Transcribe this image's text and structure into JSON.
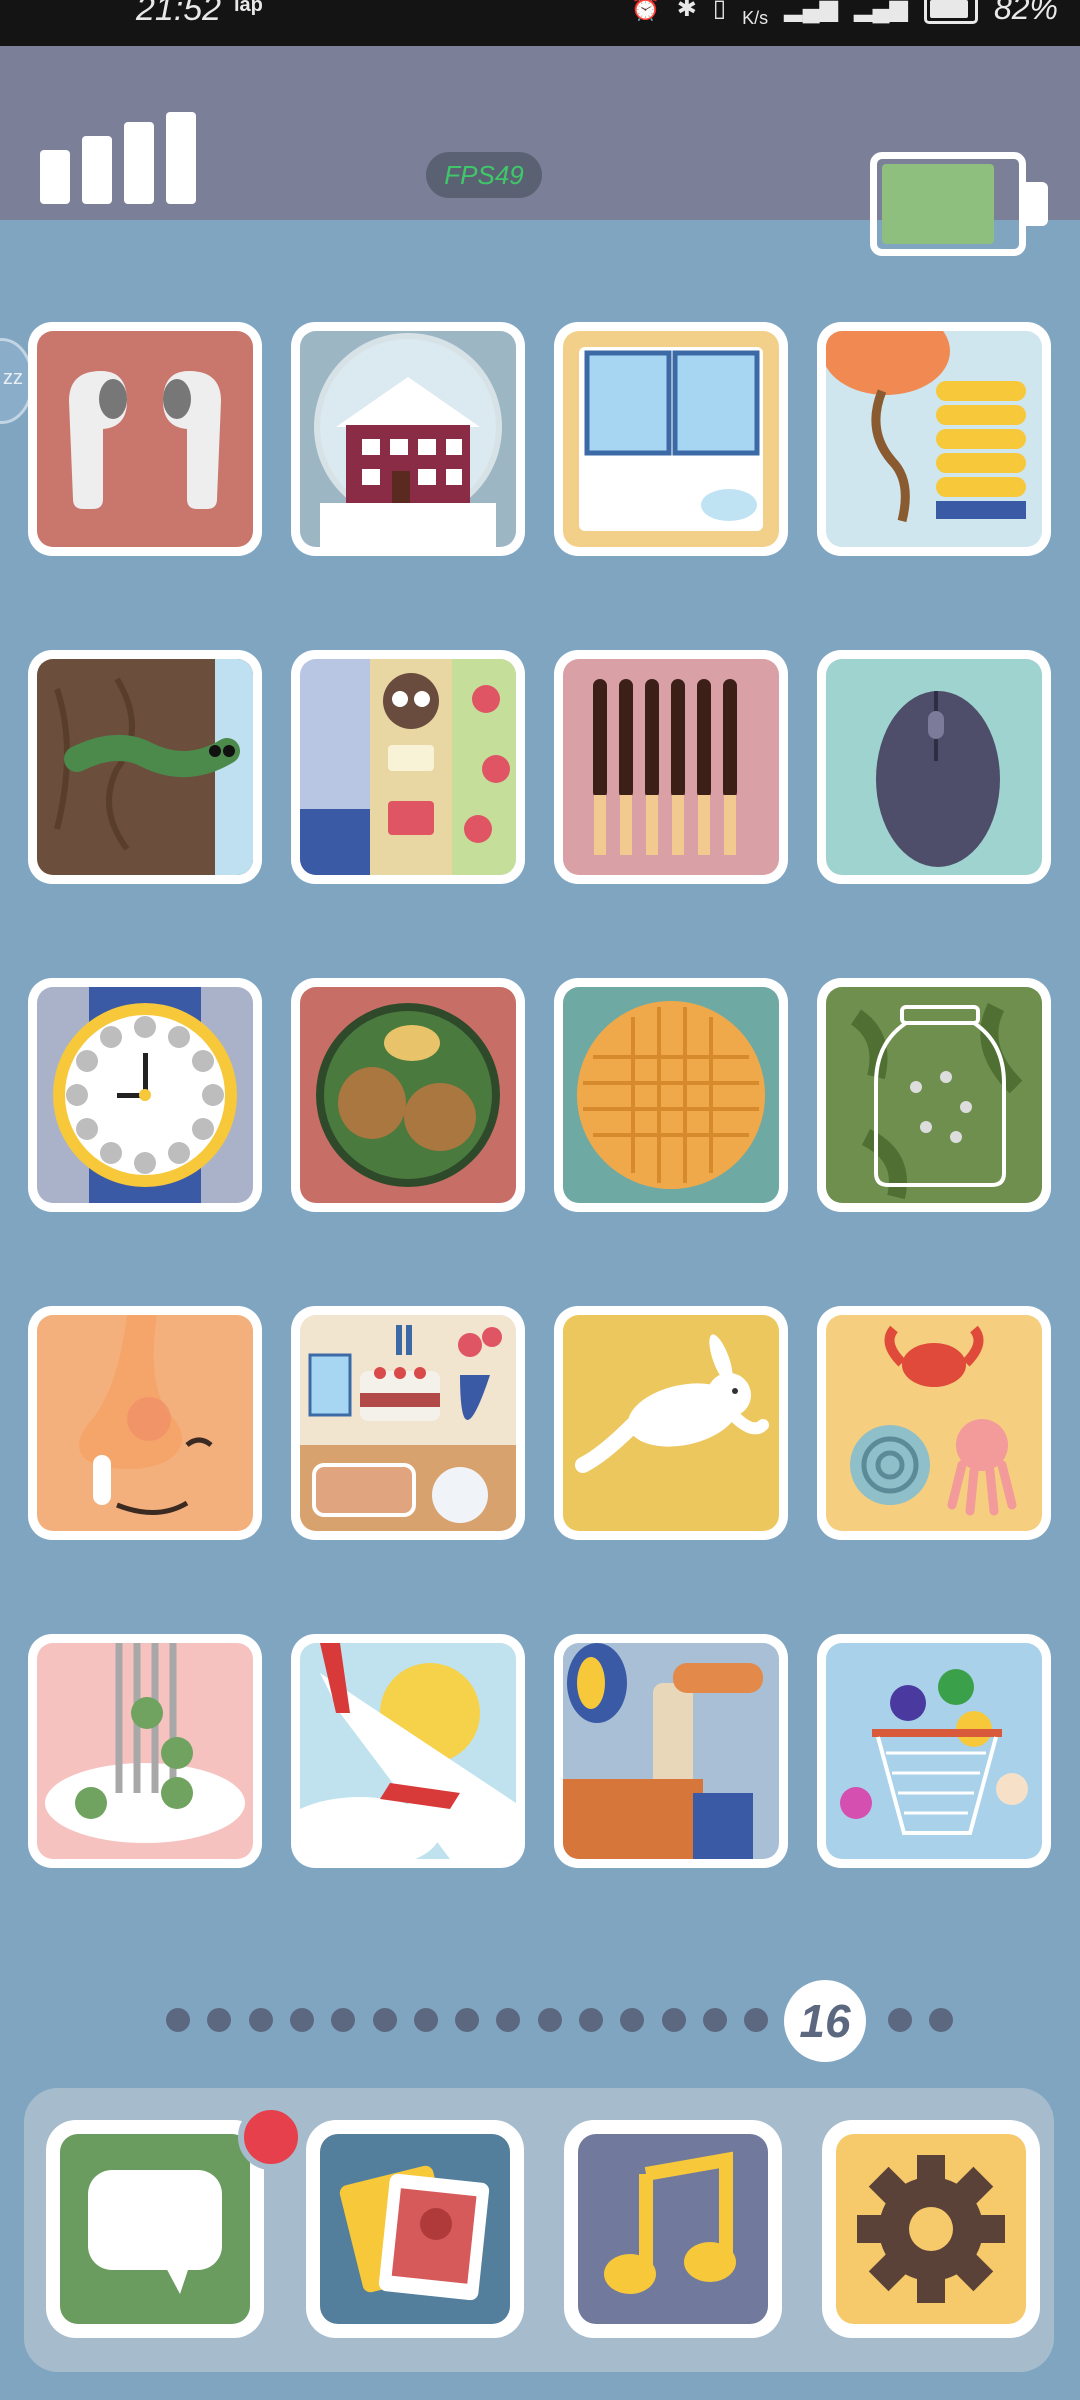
{
  "status_bar": {
    "time": "21:52",
    "tag": "iap",
    "speed_value": "",
    "speed_unit": "K/s",
    "battery_percent": "82%"
  },
  "hud": {
    "fps_label": "FPS49",
    "signal_bars": 4,
    "battery_level": 0.8,
    "battery_color": "#8fbf7f"
  },
  "grid": {
    "rows": [
      [
        {
          "name": "earbuds",
          "bg": "#c9776d"
        },
        {
          "name": "snow-globe-house",
          "bg": "#9cb6c4"
        },
        {
          "name": "window-frame",
          "bg": "#f2d089"
        },
        {
          "name": "balloon-pump",
          "bg": "#cfe6ef"
        }
      ],
      [
        {
          "name": "worm-in-wood",
          "bg": "#6b4e3b"
        },
        {
          "name": "bookshelf-owl",
          "bg": "#b9c6e3"
        },
        {
          "name": "chocolate-sticks",
          "bg": "#d9a1a6"
        },
        {
          "name": "computer-mouse",
          "bg": "#9fd3cf"
        }
      ],
      [
        {
          "name": "wrist-watch",
          "bg": "#a9b2c9"
        },
        {
          "name": "walnuts-plate",
          "bg": "#c76f66"
        },
        {
          "name": "waffle",
          "bg": "#6fa9a4"
        },
        {
          "name": "jar-of-flies",
          "bg": "#6f8f4f"
        }
      ],
      [
        {
          "name": "nose-face",
          "bg": "#f3b07c"
        },
        {
          "name": "birthday-table",
          "bg": "#e8c79e"
        },
        {
          "name": "jumping-rabbit",
          "bg": "#ecc75d"
        },
        {
          "name": "sea-creatures",
          "bg": "#f5cf7f"
        }
      ],
      [
        {
          "name": "fork-peas",
          "bg": "#f6c2c0"
        },
        {
          "name": "airplane-wing",
          "bg": "#bfe2ee"
        },
        {
          "name": "lamp-faucet",
          "bg": "#a9bfd6"
        },
        {
          "name": "basketball-hoop",
          "bg": "#a9d2ea"
        }
      ]
    ]
  },
  "pager": {
    "total_dots": 18,
    "current_page": "16",
    "current_index": 15
  },
  "dock": {
    "apps": [
      {
        "name": "messages",
        "bg": "#6a9b5f",
        "badge": true
      },
      {
        "name": "photos",
        "bg": "#537e9c",
        "badge": false
      },
      {
        "name": "music",
        "bg": "#717a9c",
        "badge": false
      },
      {
        "name": "settings",
        "bg": "#f6c96a",
        "badge": false
      }
    ]
  }
}
